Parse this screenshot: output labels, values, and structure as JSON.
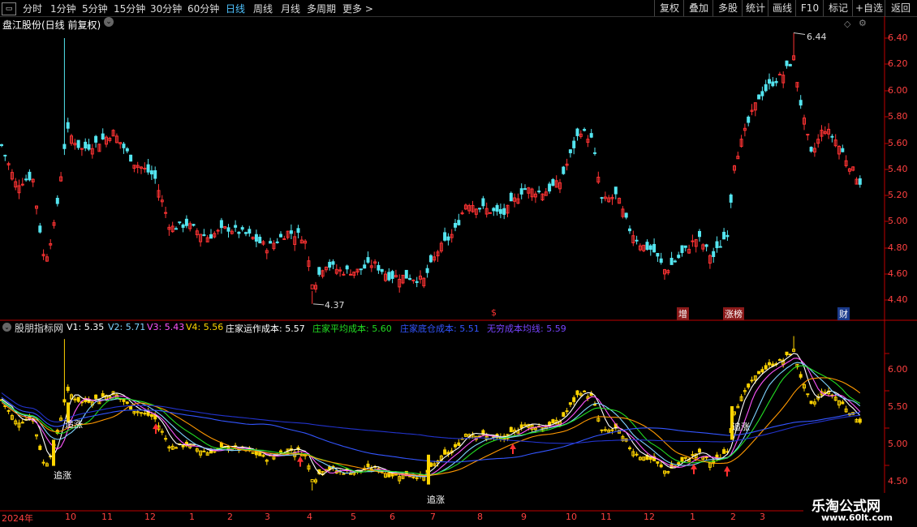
{
  "toolbar": {
    "periods": [
      "分时",
      "1分钟",
      "5分钟",
      "15分钟",
      "30分钟",
      "60分钟",
      "日线",
      "周线",
      "月线",
      "多周期",
      "更多 >"
    ],
    "active_period": "日线",
    "actions": [
      "复权",
      "叠加",
      "多股",
      "统计",
      "画线",
      "F10",
      "标记",
      "+自选",
      "返回"
    ]
  },
  "main_chart": {
    "title": "盘江股份(日线 前复权)",
    "price_ticks": [
      "6.40",
      "6.20",
      "6.00",
      "5.80",
      "5.60",
      "5.40",
      "5.20",
      "5.00",
      "4.80",
      "4.60",
      "4.40"
    ],
    "high_label": "6.44",
    "low_label": "4.37",
    "events": [
      "$",
      "增",
      "涨榜",
      "财"
    ]
  },
  "indicator": {
    "name": "股朋指标网",
    "values": [
      {
        "label": "V1:",
        "value": "5.35",
        "color": "#ffffff"
      },
      {
        "label": "V2:",
        "value": "5.71",
        "color": "#7fd4ff"
      },
      {
        "label": "V3:",
        "value": "5.43",
        "color": "#ff55ff"
      },
      {
        "label": "V4:",
        "value": "5.56",
        "color": "#ffd700"
      },
      {
        "label": "庄家运作成本:",
        "value": "5.57",
        "color": "#ffffff"
      },
      {
        "label": "庄家平均成本:",
        "value": "5.60",
        "color": "#22dd22"
      },
      {
        "label": "庄家底仓成本:",
        "value": "5.51",
        "color": "#3355ff"
      },
      {
        "label": "无穷成本均线:",
        "value": "5.59",
        "color": "#7744ff"
      }
    ],
    "ticks": [
      "6.00",
      "5.50",
      "5.00",
      "4.50"
    ],
    "signal_label": "追涨"
  },
  "time_axis": [
    "2024年",
    "10",
    "11",
    "12",
    "1",
    "2",
    "3",
    "4",
    "5",
    "6",
    "7",
    "8",
    "9",
    "10",
    "11",
    "12",
    "1",
    "2",
    "3"
  ],
  "watermark": {
    "title": "乐淘公式网",
    "url": "www.60lt.com"
  },
  "colors": {
    "up": "#ff3333",
    "down": "#54e5f0",
    "axis": "#c00000",
    "signal": "#ffd400"
  }
}
